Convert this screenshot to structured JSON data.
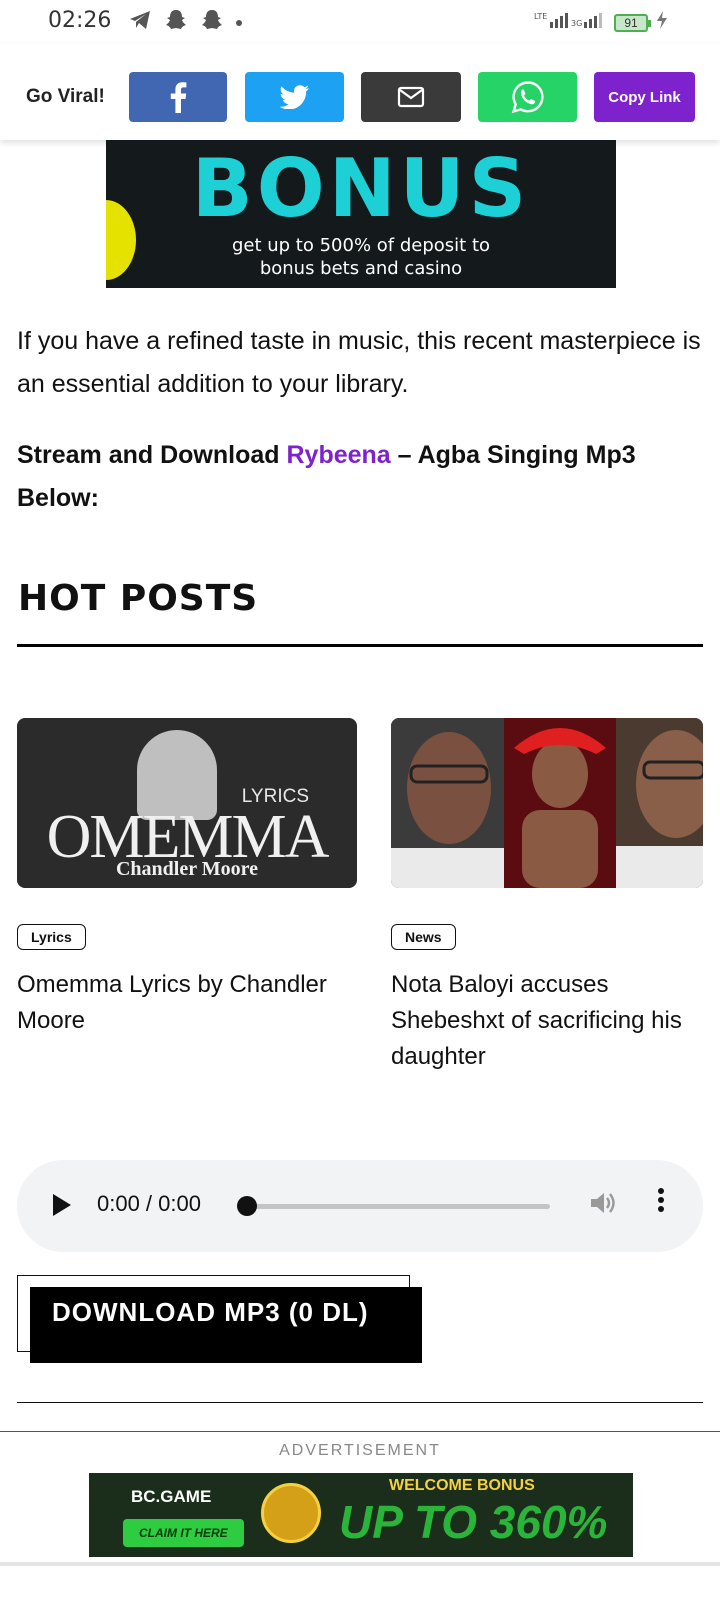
{
  "status_bar": {
    "time": "02:26",
    "battery": "91",
    "network": "LTE 3G"
  },
  "share_bar": {
    "label": "Go Viral!",
    "copy_link": "Copy Link",
    "colors": {
      "facebook": "#4267b2",
      "twitter": "#1da1f2",
      "email": "#3a3a3a",
      "whatsapp": "#25d366",
      "copy_link": "#7e22ce"
    }
  },
  "bonus_ad": {
    "title": "BONUS",
    "subtitle_line1": "get up to 500% of deposit to",
    "subtitle_line2": "bonus bets and casino"
  },
  "article": {
    "paragraph": "If you have a refined taste in music, this recent masterpiece is an essential addition to your library.",
    "stream_prefix": "Stream and Download ",
    "artist_link": "Rybeena",
    "stream_suffix": " – Agba Singing Mp3 Below:"
  },
  "hot_posts": {
    "heading": "HOT POSTS",
    "posts": [
      {
        "tag": "Lyrics",
        "title": "Omemma Lyrics by Chandler Moore",
        "thumb_lyrics": "LYRICS",
        "thumb_title": "OMEMMA",
        "thumb_artist": "Chandler Moore"
      },
      {
        "tag": "News",
        "title": "Nota Baloyi accuses Shebeshxt of sacrificing his daughter"
      }
    ]
  },
  "audio_player": {
    "time": "0:00 / 0:00",
    "progress": 0
  },
  "download": {
    "label": "DOWNLOAD MP3 (0 DL)"
  },
  "advertisement": {
    "label": "ADVERTISEMENT",
    "brand": "BC.GAME",
    "claim": "CLAIM IT HERE",
    "welcome": "WELCOME BONUS",
    "offer": "UP TO 360%"
  }
}
